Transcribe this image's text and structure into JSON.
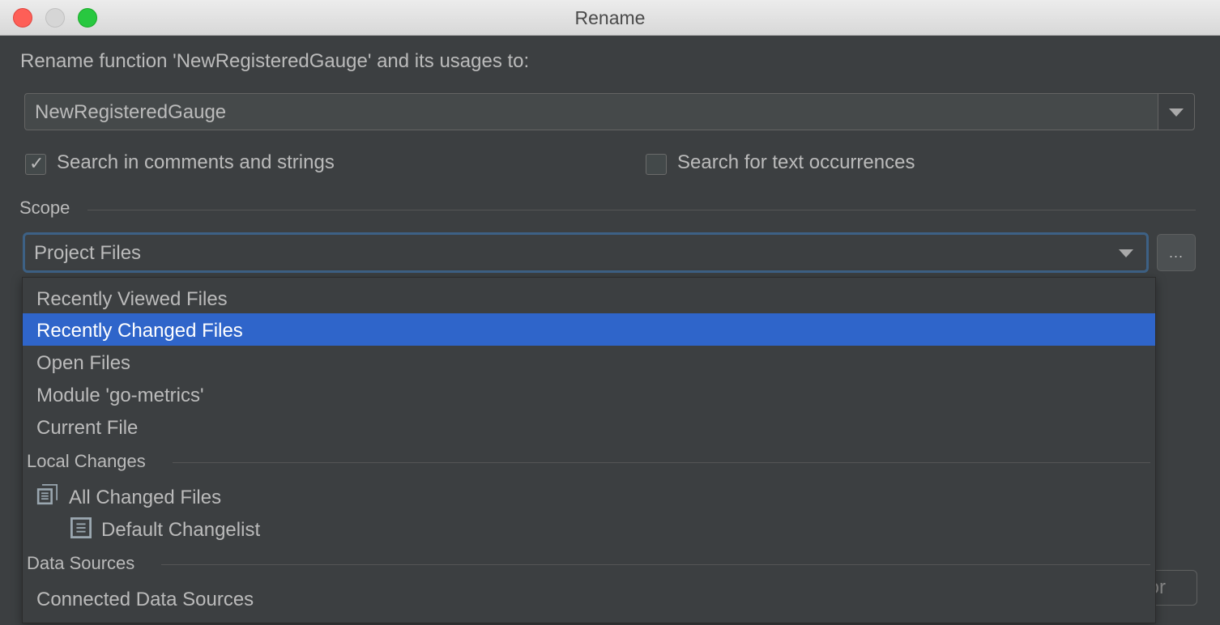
{
  "window": {
    "title": "Rename",
    "controls": [
      "close",
      "minimize",
      "maximize"
    ]
  },
  "dialog": {
    "prompt": "Rename function 'NewRegisteredGauge' and its usages to:",
    "name_field": {
      "value": "NewRegisteredGauge"
    },
    "options": [
      {
        "label": "Search in comments and strings",
        "checked": true
      },
      {
        "label": "Search for text occurrences",
        "checked": false
      }
    ],
    "scope": {
      "label": "Scope",
      "selected": "Project Files",
      "more_button": "..."
    },
    "background_button_partial": "or"
  },
  "scope_dropdown": {
    "items": [
      {
        "label": "Recently Viewed Files",
        "selected": false
      },
      {
        "label": "Recently Changed Files",
        "selected": true
      },
      {
        "label": "Open Files",
        "selected": false
      },
      {
        "label": "Module 'go-metrics'",
        "selected": false
      },
      {
        "label": "Current File",
        "selected": false
      }
    ],
    "groups": [
      {
        "title": "Local Changes",
        "items": [
          {
            "label": "All Changed Files",
            "icon": "changelist-stack-icon"
          },
          {
            "label": "Default Changelist",
            "icon": "changelist-icon"
          }
        ]
      },
      {
        "title": "Data Sources",
        "items": [
          {
            "label": "Connected Data Sources"
          }
        ]
      }
    ]
  },
  "colors": {
    "background": "#3c3f41",
    "selection": "#2f65ca",
    "focus_border": "#3d6185",
    "text": "#bbbbbb"
  }
}
